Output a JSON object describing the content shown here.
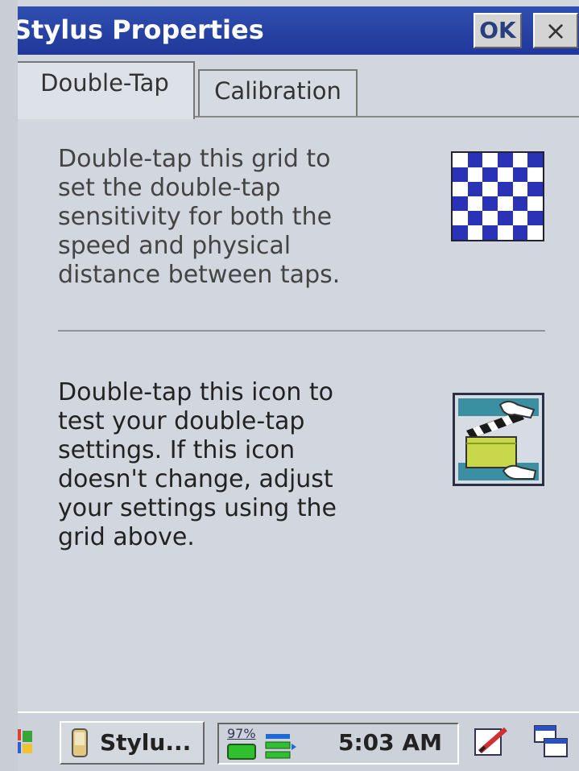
{
  "window": {
    "title": "Stylus Properties",
    "ok_label": "OK",
    "close_label": "×"
  },
  "tabs": [
    {
      "label": "Double-Tap",
      "active": true
    },
    {
      "label": "Calibration",
      "active": false
    }
  ],
  "content": {
    "grid_text": "Double-tap this grid to\nset the double-tap\nsensitivity for both the\nspeed and physical\ndistance between taps.",
    "icon_text": "Double-tap this icon to\ntest your double-tap\nsettings. If this icon\ndoesn't change, adjust\nyour settings using the\ngrid above.",
    "grid_icon": "checkerboard-grid",
    "test_icon": "clapperboard-hands"
  },
  "taskbar": {
    "task_label": "Stylu...",
    "battery_percent": "97%",
    "time": "5:03 AM",
    "icons": [
      "start-flag-icon",
      "device-icon",
      "battery-icon",
      "network-icon",
      "pen-icon",
      "windows-icon"
    ]
  },
  "colors": {
    "titlebar": "#2f4fb0",
    "checker_blue": "#2a33b5",
    "background": "#d2d7df"
  }
}
